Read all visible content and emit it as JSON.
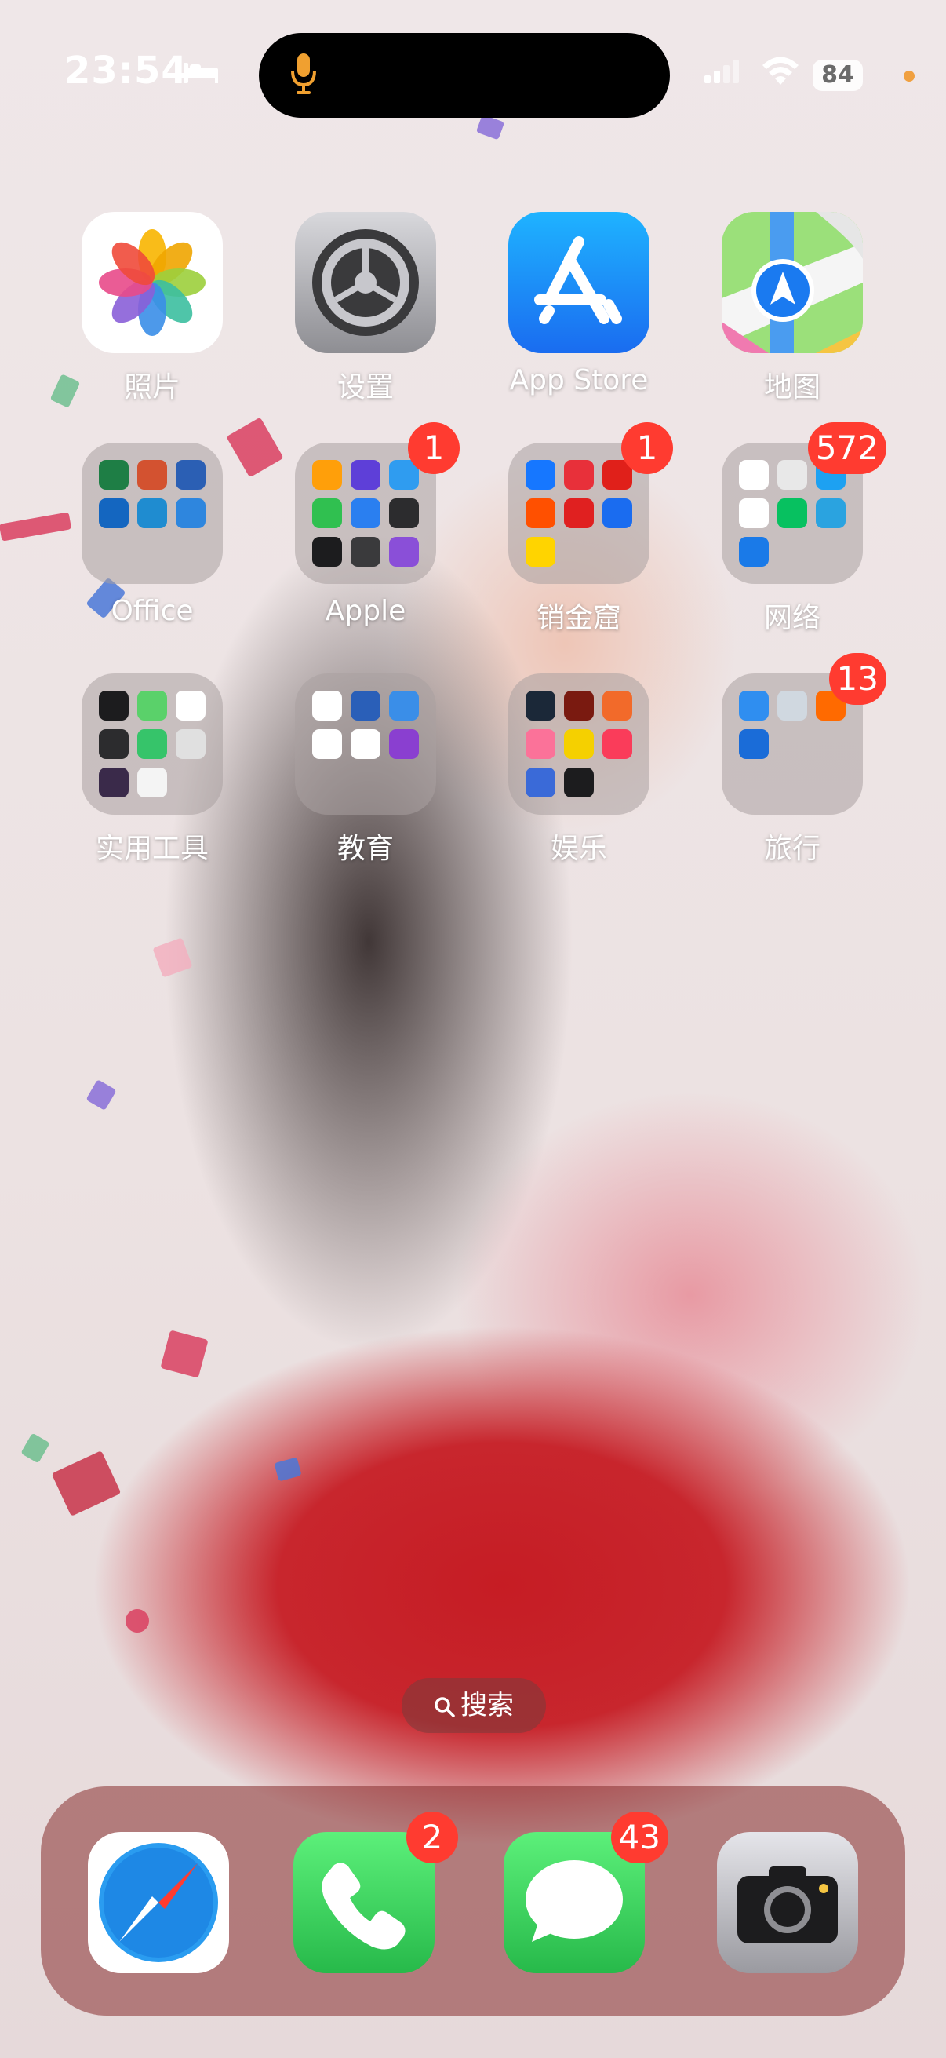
{
  "status_bar": {
    "time": "23:54",
    "battery": "84"
  },
  "home": {
    "apps": [
      {
        "label": "照片",
        "icon": "photos-icon"
      },
      {
        "label": "设置",
        "icon": "settings-gear-icon"
      },
      {
        "label": "App Store",
        "icon": "app-store-icon"
      },
      {
        "label": "地图",
        "icon": "maps-icon"
      },
      {
        "label": "Office",
        "icon": "folder-icon"
      },
      {
        "label": "Apple",
        "icon": "folder-icon",
        "badge": "1"
      },
      {
        "label": "销金窟",
        "icon": "folder-icon",
        "badge": "1"
      },
      {
        "label": "网络",
        "icon": "folder-icon",
        "badge": "572"
      },
      {
        "label": "实用工具",
        "icon": "folder-icon"
      },
      {
        "label": "教育",
        "icon": "folder-icon"
      },
      {
        "label": "娱乐",
        "icon": "folder-icon"
      },
      {
        "label": "旅行",
        "icon": "folder-icon",
        "badge": "13"
      }
    ]
  },
  "search": {
    "label": "搜索"
  },
  "dock": {
    "apps": [
      {
        "name": "safari",
        "icon": "safari-compass-icon"
      },
      {
        "name": "phone",
        "icon": "phone-handset-icon",
        "badge": "2"
      },
      {
        "name": "messages",
        "icon": "message-bubble-icon",
        "badge": "43"
      },
      {
        "name": "camera",
        "icon": "camera-icon"
      }
    ]
  },
  "colors": {
    "badge": "#ff3b30",
    "appstore_blue": "#1a8cff",
    "phone_green": "#35c759"
  }
}
